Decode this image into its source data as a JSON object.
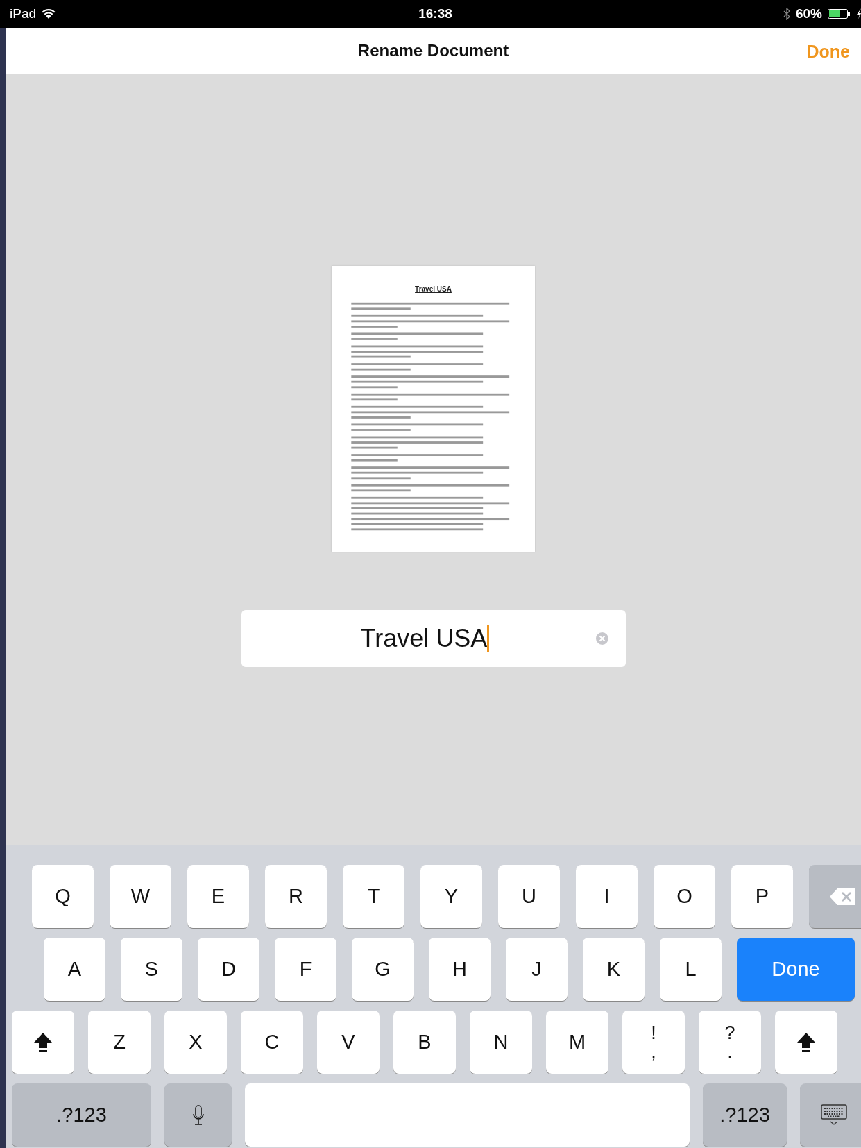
{
  "status_bar": {
    "device": "iPad",
    "time": "16:38",
    "battery_text": "60%"
  },
  "nav_bar": {
    "title": "Rename Document",
    "done_button": "Done"
  },
  "document_thumbnail": {
    "title": "Travel USA"
  },
  "name_field": {
    "value": "Travel USA"
  },
  "keyboard": {
    "rows": [
      {
        "keys": [
          {
            "kind": "letter",
            "label": "Q"
          },
          {
            "kind": "letter",
            "label": "W"
          },
          {
            "kind": "letter",
            "label": "E"
          },
          {
            "kind": "letter",
            "label": "R"
          },
          {
            "kind": "letter",
            "label": "T"
          },
          {
            "kind": "letter",
            "label": "Y"
          },
          {
            "kind": "letter",
            "label": "U"
          },
          {
            "kind": "letter",
            "label": "I"
          },
          {
            "kind": "letter",
            "label": "O"
          },
          {
            "kind": "letter",
            "label": "P"
          },
          {
            "kind": "backspace"
          }
        ]
      },
      {
        "keys": [
          {
            "kind": "letter",
            "label": "A"
          },
          {
            "kind": "letter",
            "label": "S"
          },
          {
            "kind": "letter",
            "label": "D"
          },
          {
            "kind": "letter",
            "label": "F"
          },
          {
            "kind": "letter",
            "label": "G"
          },
          {
            "kind": "letter",
            "label": "H"
          },
          {
            "kind": "letter",
            "label": "J"
          },
          {
            "kind": "letter",
            "label": "K"
          },
          {
            "kind": "letter",
            "label": "L"
          },
          {
            "kind": "return",
            "label": "Done"
          }
        ]
      },
      {
        "keys": [
          {
            "kind": "shift"
          },
          {
            "kind": "letter",
            "label": "Z"
          },
          {
            "kind": "letter",
            "label": "X"
          },
          {
            "kind": "letter",
            "label": "C"
          },
          {
            "kind": "letter",
            "label": "V"
          },
          {
            "kind": "letter",
            "label": "B"
          },
          {
            "kind": "letter",
            "label": "N"
          },
          {
            "kind": "letter",
            "label": "M"
          },
          {
            "kind": "punct",
            "label": "!",
            "sub": ","
          },
          {
            "kind": "punct",
            "label": "?",
            "sub": "."
          },
          {
            "kind": "shift"
          }
        ]
      },
      {
        "keys": [
          {
            "kind": "numbers",
            "label": ".?123"
          },
          {
            "kind": "mic"
          },
          {
            "kind": "space"
          },
          {
            "kind": "numbers",
            "label": ".?123"
          },
          {
            "kind": "hide"
          }
        ]
      }
    ]
  }
}
